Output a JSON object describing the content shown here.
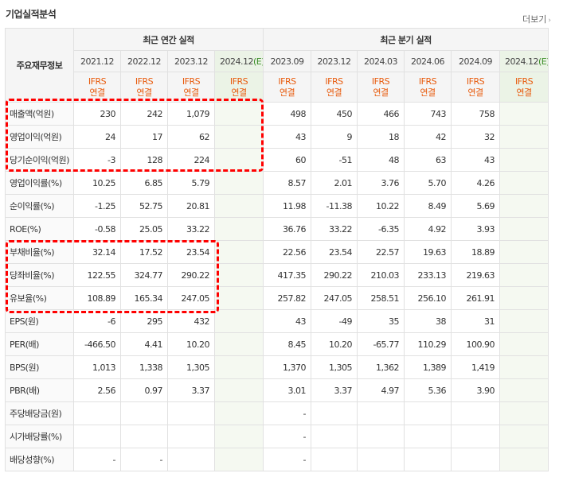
{
  "section_title": "기업실적분석",
  "more_label": "더보기",
  "more_arrow": "›",
  "corner_label": "주요재무정보",
  "group_annual": "최근 연간 실적",
  "group_quarter": "최근 분기 실적",
  "annual_periods": [
    "2021.12",
    "2022.12",
    "2023.12"
  ],
  "annual_estimate": {
    "period": "2024.12",
    "mark": "(E)"
  },
  "quarter_periods": [
    "2023.09",
    "2023.12",
    "2024.03",
    "2024.06",
    "2024.09"
  ],
  "quarter_estimate": {
    "period": "2024.12",
    "mark": "(E)"
  },
  "accounting": {
    "standard": "IFRS",
    "basis": "연결"
  },
  "rows": [
    {
      "label": "매출액(억원)",
      "annual": [
        "230",
        "242",
        "1,079"
      ],
      "annual_est": "",
      "quarter": [
        "498",
        "450",
        "466",
        "743",
        "758"
      ],
      "quarter_est": ""
    },
    {
      "label": "영업이익(억원)",
      "annual": [
        "24",
        "17",
        "62"
      ],
      "annual_est": "",
      "quarter": [
        "43",
        "9",
        "18",
        "42",
        "32"
      ],
      "quarter_est": ""
    },
    {
      "label": "당기순이익(억원)",
      "annual": [
        "-3",
        "128",
        "224"
      ],
      "annual_est": "",
      "quarter": [
        "60",
        "-51",
        "48",
        "63",
        "43"
      ],
      "quarter_est": ""
    },
    {
      "label": "영업이익률(%)",
      "annual": [
        "10.25",
        "6.85",
        "5.79"
      ],
      "annual_est": "",
      "quarter": [
        "8.57",
        "2.01",
        "3.76",
        "5.70",
        "4.26"
      ],
      "quarter_est": ""
    },
    {
      "label": "순이익률(%)",
      "annual": [
        "-1.25",
        "52.75",
        "20.81"
      ],
      "annual_est": "",
      "quarter": [
        "11.98",
        "-11.38",
        "10.22",
        "8.49",
        "5.69"
      ],
      "quarter_est": ""
    },
    {
      "label": "ROE(%)",
      "annual": [
        "-0.58",
        "25.05",
        "33.22"
      ],
      "annual_est": "",
      "quarter": [
        "36.76",
        "33.22",
        "-6.35",
        "4.92",
        "3.93"
      ],
      "quarter_est": ""
    },
    {
      "label": "부채비율(%)",
      "annual": [
        "32.14",
        "17.52",
        "23.54"
      ],
      "annual_est": "",
      "quarter": [
        "22.56",
        "23.54",
        "22.57",
        "19.63",
        "18.89"
      ],
      "quarter_est": ""
    },
    {
      "label": "당좌비율(%)",
      "annual": [
        "122.55",
        "324.77",
        "290.22"
      ],
      "annual_est": "",
      "quarter": [
        "417.35",
        "290.22",
        "210.03",
        "233.13",
        "219.63"
      ],
      "quarter_est": ""
    },
    {
      "label": "유보율(%)",
      "annual": [
        "108.89",
        "165.34",
        "247.05"
      ],
      "annual_est": "",
      "quarter": [
        "257.82",
        "247.05",
        "258.51",
        "256.10",
        "261.91"
      ],
      "quarter_est": ""
    },
    {
      "label": "EPS(원)",
      "annual": [
        "-6",
        "295",
        "432"
      ],
      "annual_est": "",
      "quarter": [
        "43",
        "-49",
        "35",
        "38",
        "31"
      ],
      "quarter_est": ""
    },
    {
      "label": "PER(배)",
      "annual": [
        "-466.50",
        "4.41",
        "10.20"
      ],
      "annual_est": "",
      "quarter": [
        "8.45",
        "10.20",
        "-65.77",
        "110.29",
        "100.90"
      ],
      "quarter_est": ""
    },
    {
      "label": "BPS(원)",
      "annual": [
        "1,013",
        "1,338",
        "1,305"
      ],
      "annual_est": "",
      "quarter": [
        "1,370",
        "1,305",
        "1,362",
        "1,389",
        "1,419"
      ],
      "quarter_est": ""
    },
    {
      "label": "PBR(배)",
      "annual": [
        "2.56",
        "0.97",
        "3.37"
      ],
      "annual_est": "",
      "quarter": [
        "3.01",
        "3.37",
        "4.97",
        "5.36",
        "3.90"
      ],
      "quarter_est": ""
    },
    {
      "label": "주당배당금(원)",
      "annual": [
        "",
        "",
        ""
      ],
      "annual_est": "",
      "quarter": [
        "-",
        "",
        "",
        "",
        ""
      ],
      "quarter_est": ""
    },
    {
      "label": "시가배당률(%)",
      "annual": [
        "",
        "",
        ""
      ],
      "annual_est": "",
      "quarter": [
        "-",
        "",
        "",
        "",
        ""
      ],
      "quarter_est": ""
    },
    {
      "label": "배당성향(%)",
      "annual": [
        "-",
        "-",
        ""
      ],
      "annual_est": "",
      "quarter": [
        "-",
        "",
        "",
        "",
        ""
      ],
      "quarter_est": ""
    }
  ],
  "highlight_color": "#ff0000",
  "negative_color": "#e60012",
  "ifrs_color": "#e85b0d",
  "estimate_color": "#3a8d26"
}
